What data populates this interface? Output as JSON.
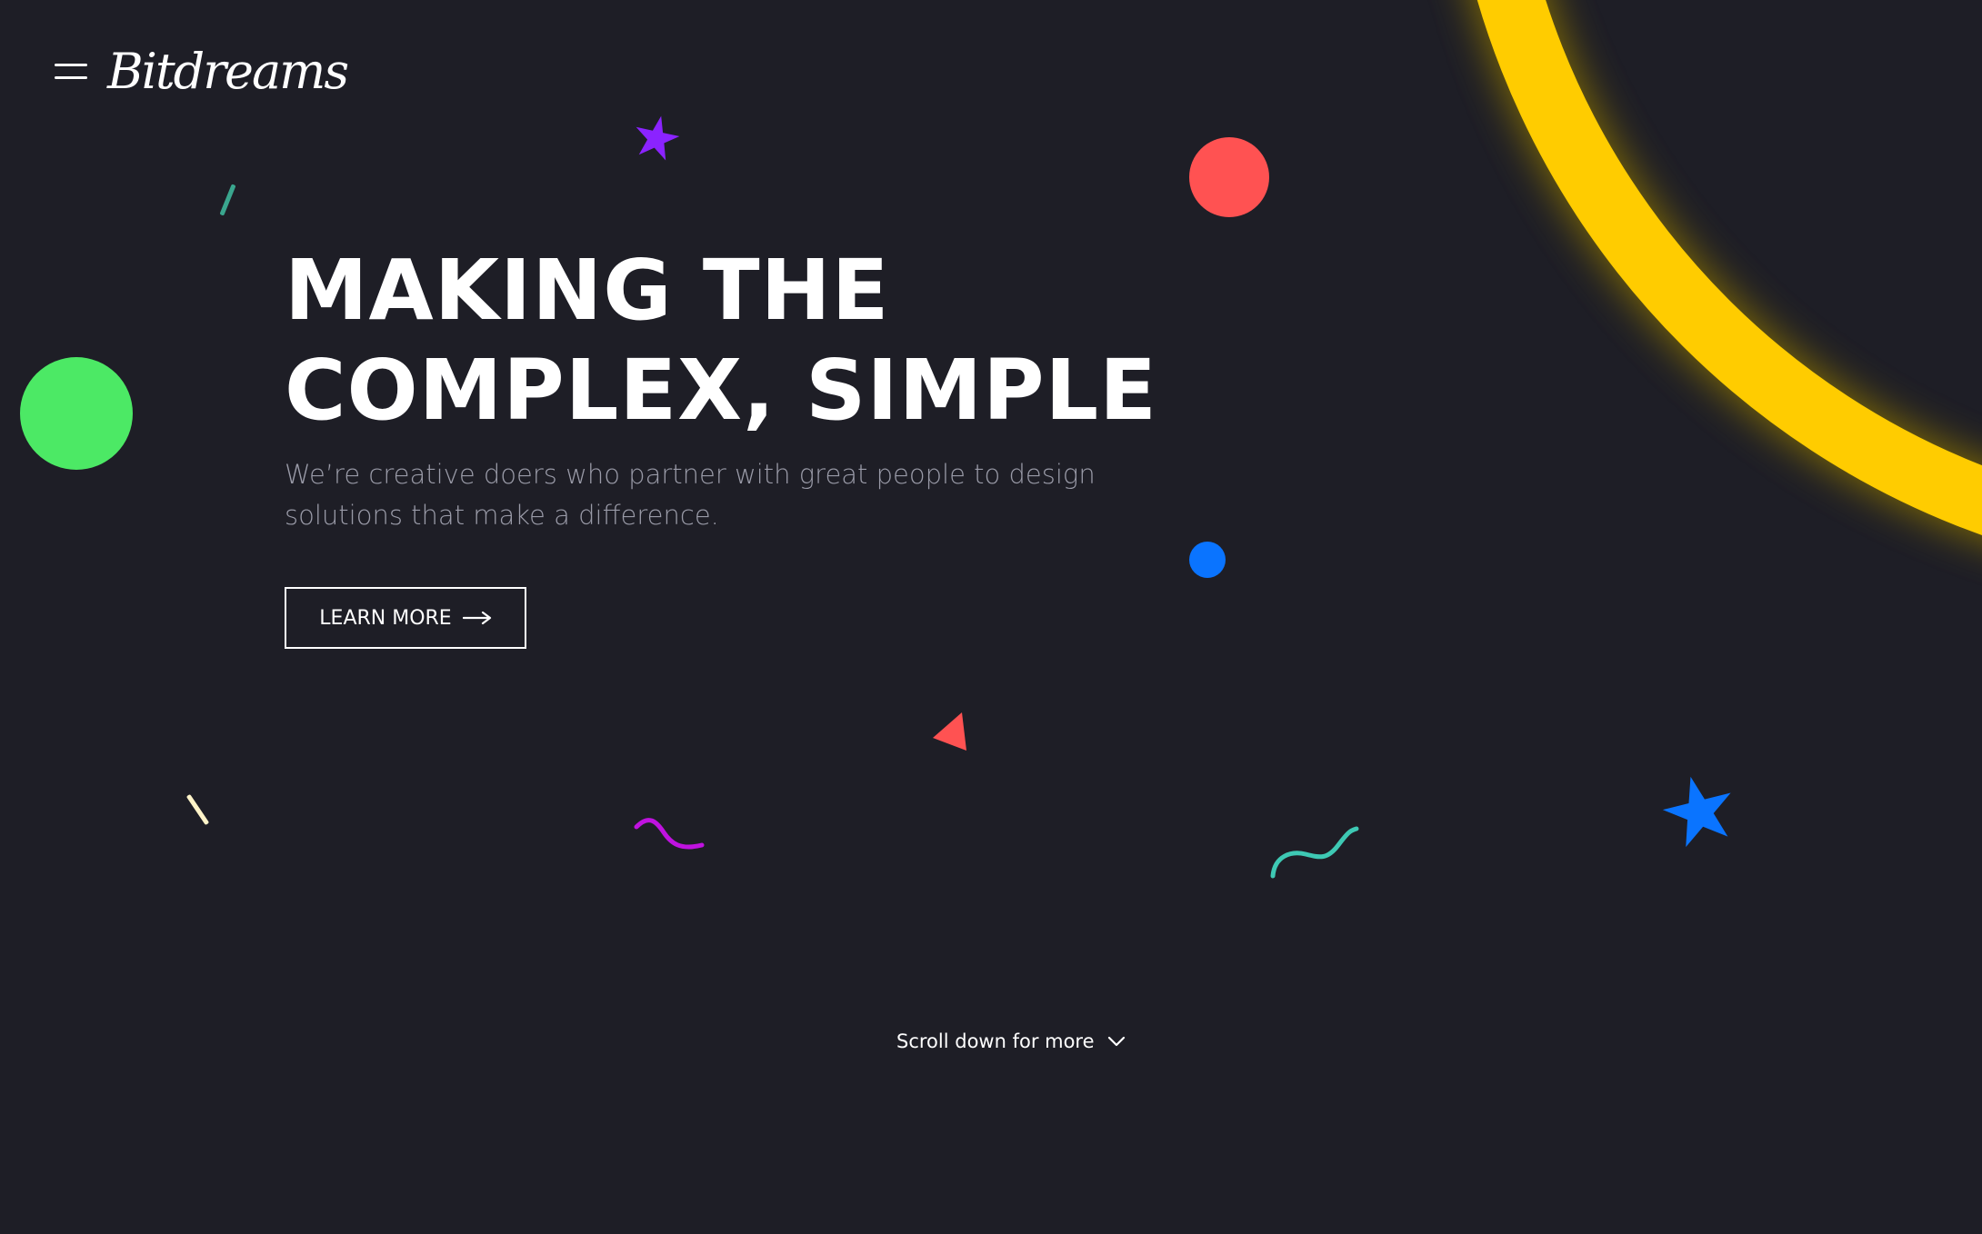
{
  "brand": {
    "logo_text": "Bitdreams"
  },
  "nav": {
    "menu_icon": "hamburger-icon"
  },
  "hero": {
    "headline_line1": "MAKING THE",
    "headline_line2": "COMPLEX, SIMPLE",
    "subtitle_line1": "We’re creative doers who partner with great people to design",
    "subtitle_line2": "solutions that make a difference.",
    "cta_label": "LEARN MORE",
    "cta_icon": "arrow-right-icon"
  },
  "footer": {
    "scroll_label": "Scroll down for more",
    "scroll_icon": "chevron-down-icon"
  },
  "colors": {
    "background": "#1e1e26",
    "ring": "#ffcc00",
    "green": "#4ce965",
    "red": "#ff5252",
    "blue": "#0a74ff",
    "purple": "#8b23ff",
    "magenta": "#c012e0",
    "teal": "#3ec9b4",
    "cream": "#fff4c9",
    "subtitle_text": "#9a9ba8"
  }
}
